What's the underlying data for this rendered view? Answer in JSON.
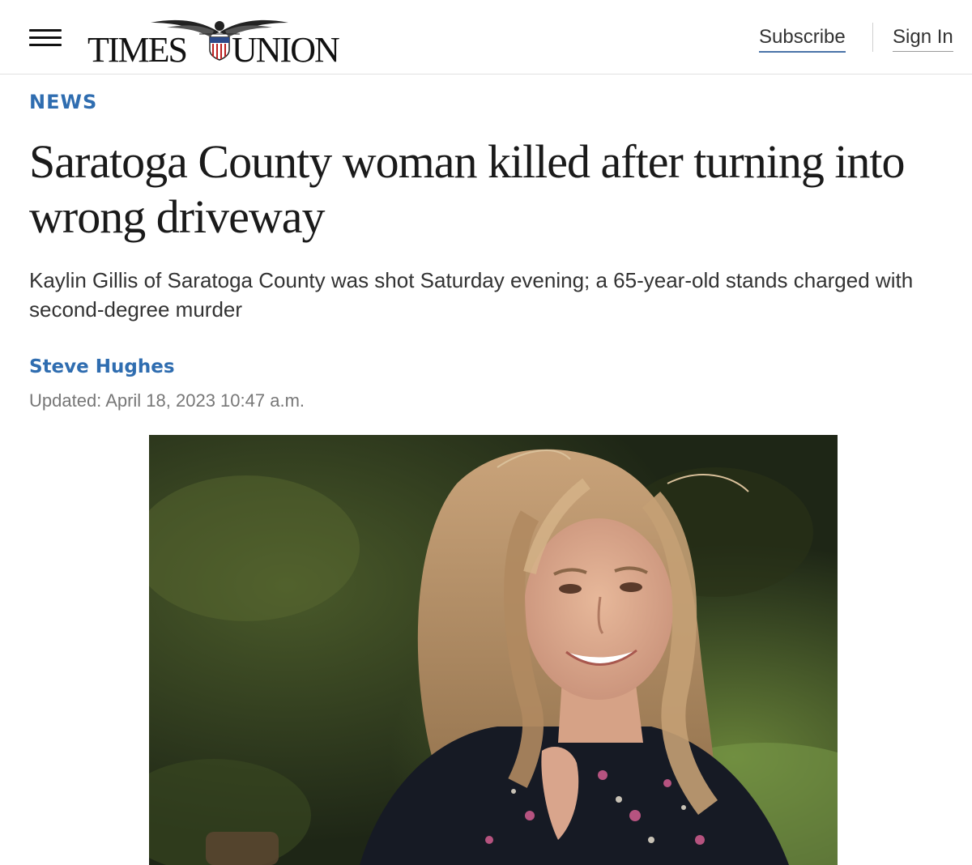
{
  "header": {
    "menu_icon": "hamburger-menu-icon",
    "logo": {
      "word_left": "TIMES",
      "word_right": "UNION",
      "emblem_icon": "eagle-emblem-icon"
    },
    "subscribe_label": "Subscribe",
    "signin_label": "Sign In",
    "accent_color": "#2f6db0"
  },
  "article": {
    "section": "NEWS",
    "headline": "Saratoga County woman killed after turning into wrong driveway",
    "dek": "Kaylin Gillis of Saratoga County was shot Saturday evening; a 65-year-old stands charged with second-degree murder",
    "author": "Steve Hughes",
    "updated": "Updated: April 18, 2023 10:47 a.m.",
    "photo": {
      "subject": "portrait of a smiling young woman with long blond hair in a dark floral top, outdoors"
    }
  }
}
